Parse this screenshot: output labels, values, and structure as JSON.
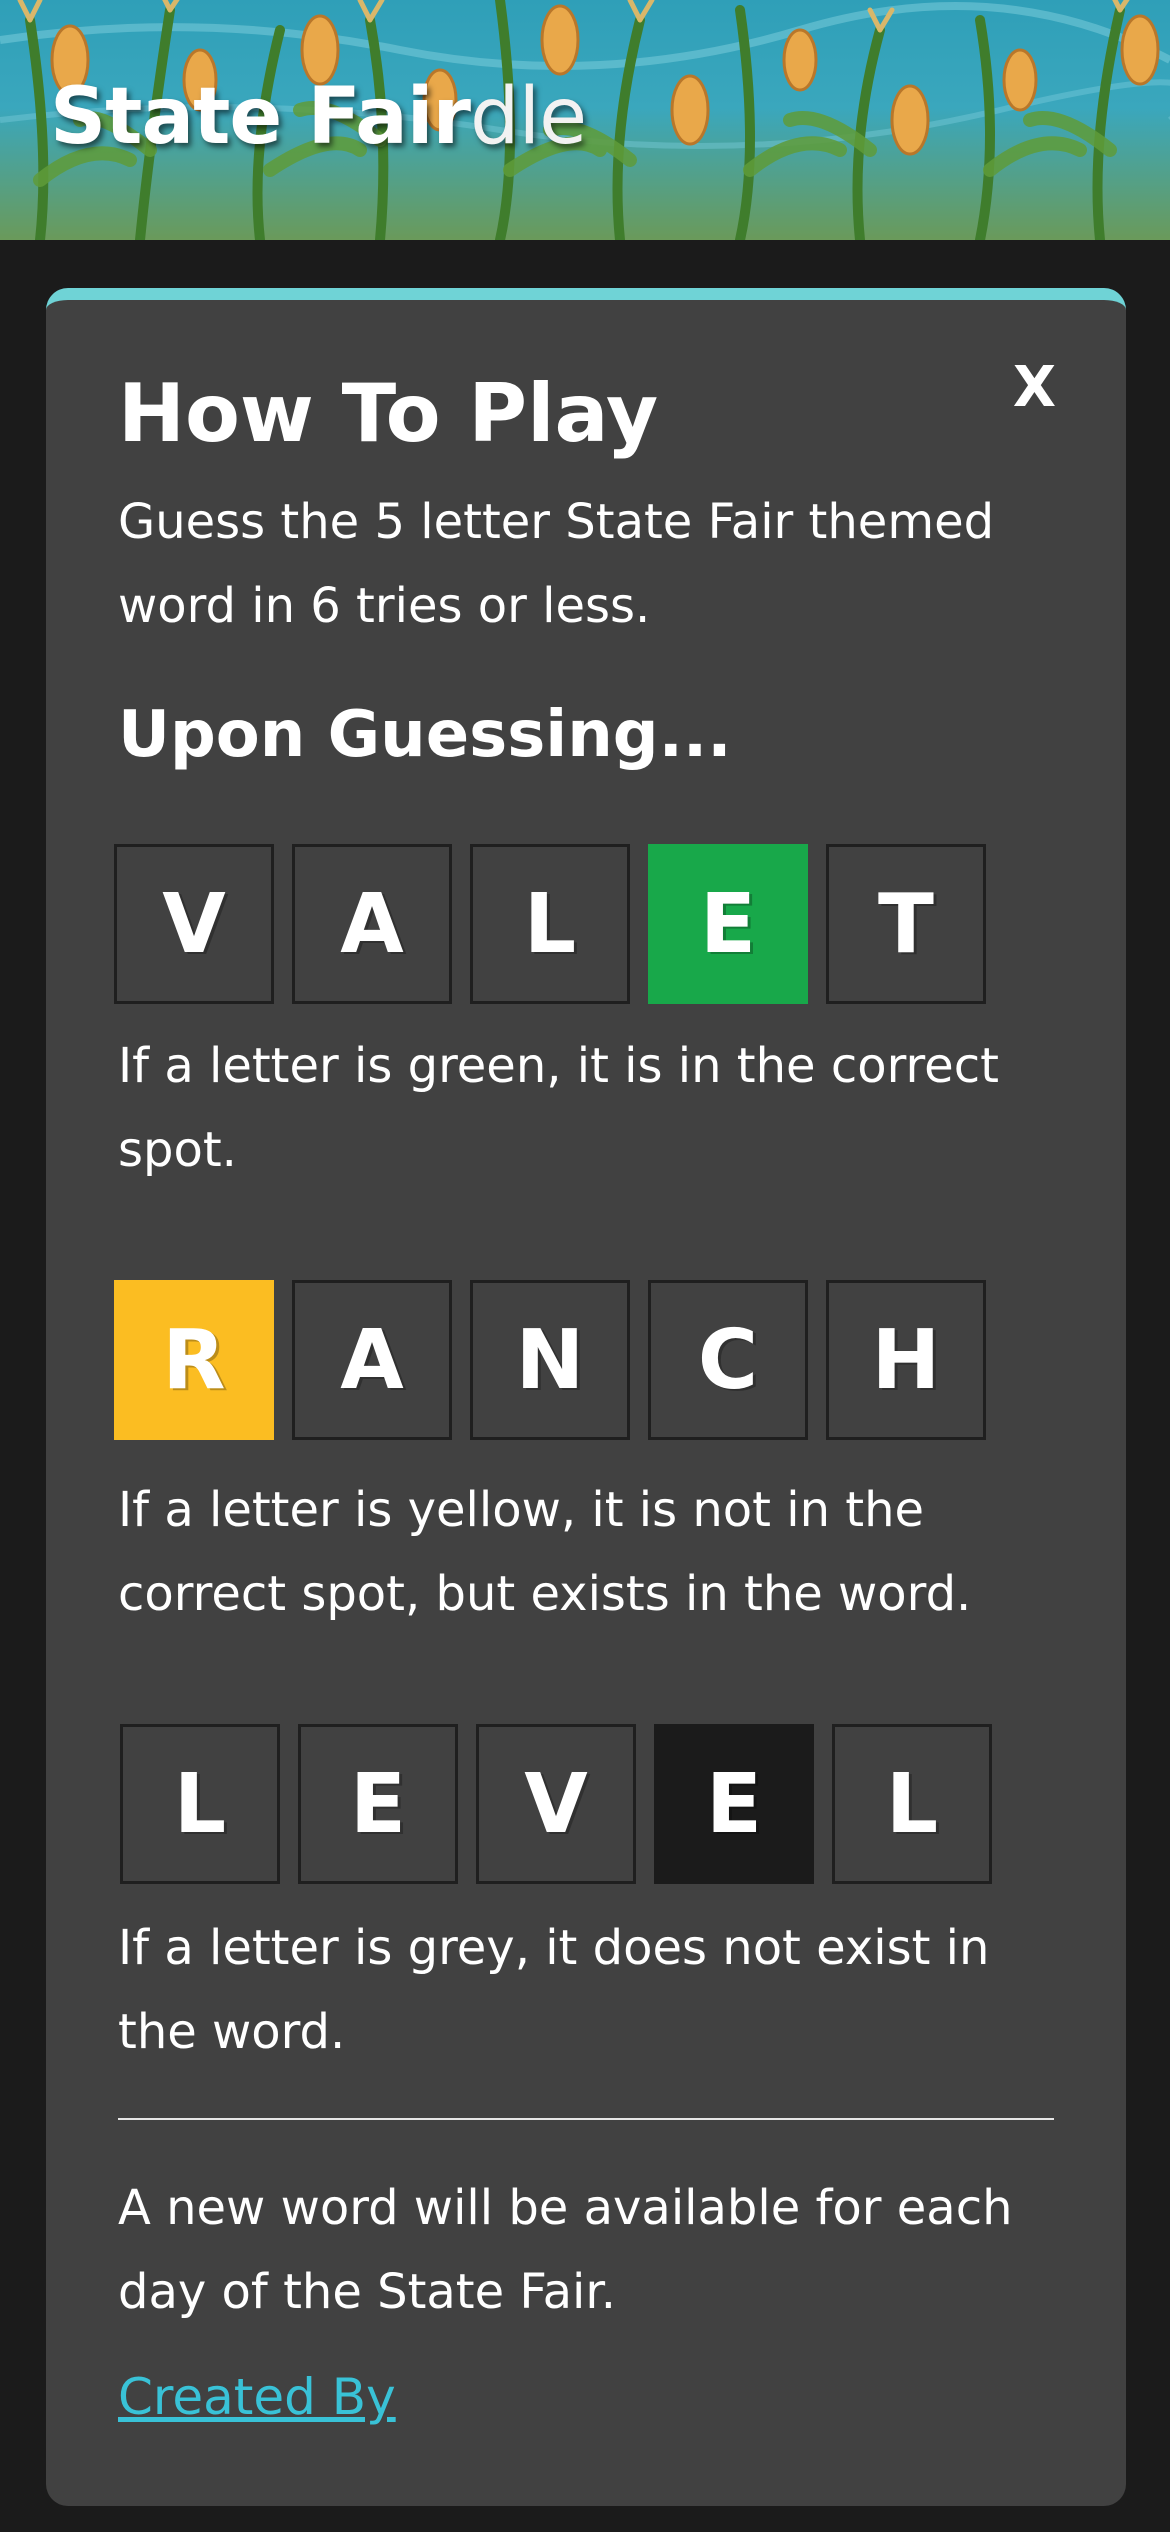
{
  "header": {
    "logo_bold": "State Fair",
    "logo_light": "dle"
  },
  "modal": {
    "close_label": "X",
    "title": "How To Play",
    "intro": "Guess the 5 letter State Fair themed word in 6 tries or less.",
    "subtitle": "Upon Guessing...",
    "examples": [
      {
        "letters": [
          "V",
          "A",
          "L",
          "E",
          "T"
        ],
        "highlight_index": 3,
        "highlight_color": "#18a84a",
        "description": "If a letter is green, it is in the correct spot."
      },
      {
        "letters": [
          "R",
          "A",
          "N",
          "C",
          "H"
        ],
        "highlight_index": 0,
        "highlight_color": "#fbbd22",
        "description": "If a letter is yellow, it is not in the correct spot, but exists in the word."
      },
      {
        "letters": [
          "L",
          "E",
          "V",
          "E",
          "L"
        ],
        "highlight_index": 3,
        "highlight_color": "#1b1b1b",
        "description": "If a letter is grey, it does not exist in the word."
      }
    ],
    "footer_note": "A new word will be available for each day of the State Fair.",
    "credits_link": "Created By"
  },
  "colors": {
    "accent_border": "#6fd3d6",
    "modal_bg": "#414141",
    "page_bg": "#1b1b1b",
    "link": "#39c2d7"
  }
}
